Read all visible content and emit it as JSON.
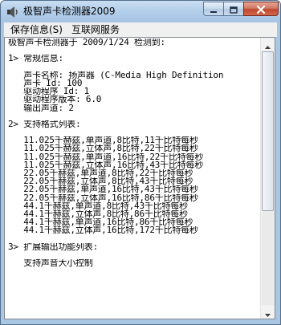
{
  "window": {
    "title": "极智声卡检测器2009"
  },
  "menu": {
    "items": [
      "保存信息(S)",
      "互联网服务"
    ]
  },
  "report": {
    "lines": [
      "极智声卡检测器于 2009/1/24 检测到:",
      "",
      "1> 常规信息:",
      "",
      "   声卡名称: 扬声器 (C-Media High Definition",
      "   声卡 Id: 100",
      "   驱动程序 Id: 1",
      "   驱动程序版本: 6.0",
      "   输出声道: 2",
      "",
      "2> 支持格式列表:",
      "",
      "   11.025千赫兹,单声道,8比特,11千比特每秒",
      "   11.025千赫兹,立体声,8比特,22千比特每秒",
      "   11.025千赫兹,单声道,16比特,22千比特每秒",
      "   11.025千赫兹,立体声,16比特,43千比特每秒",
      "   22.05千赫兹,单声道,8比特,22千比特每秒",
      "   22.05千赫兹,立体声,8比特,43千比特每秒",
      "   22.05千赫兹,单声道,16比特,43千比特每秒",
      "   22.05千赫兹,立体声,16比特,86千比特每秒",
      "   44.1千赫兹,单声道,8比特,43千比特每秒",
      "   44.1千赫兹,立体声,8比特,86千比特每秒",
      "   44.1千赫兹,单声道,16比特,86千比特每秒",
      "   44.1千赫兹,立体声,16比特,172千比特每秒",
      "",
      "3> 扩展输出功能列表:",
      "",
      "   支持声音大小控制"
    ]
  },
  "scrollbar": {
    "thumb_fraction": 0.63
  }
}
